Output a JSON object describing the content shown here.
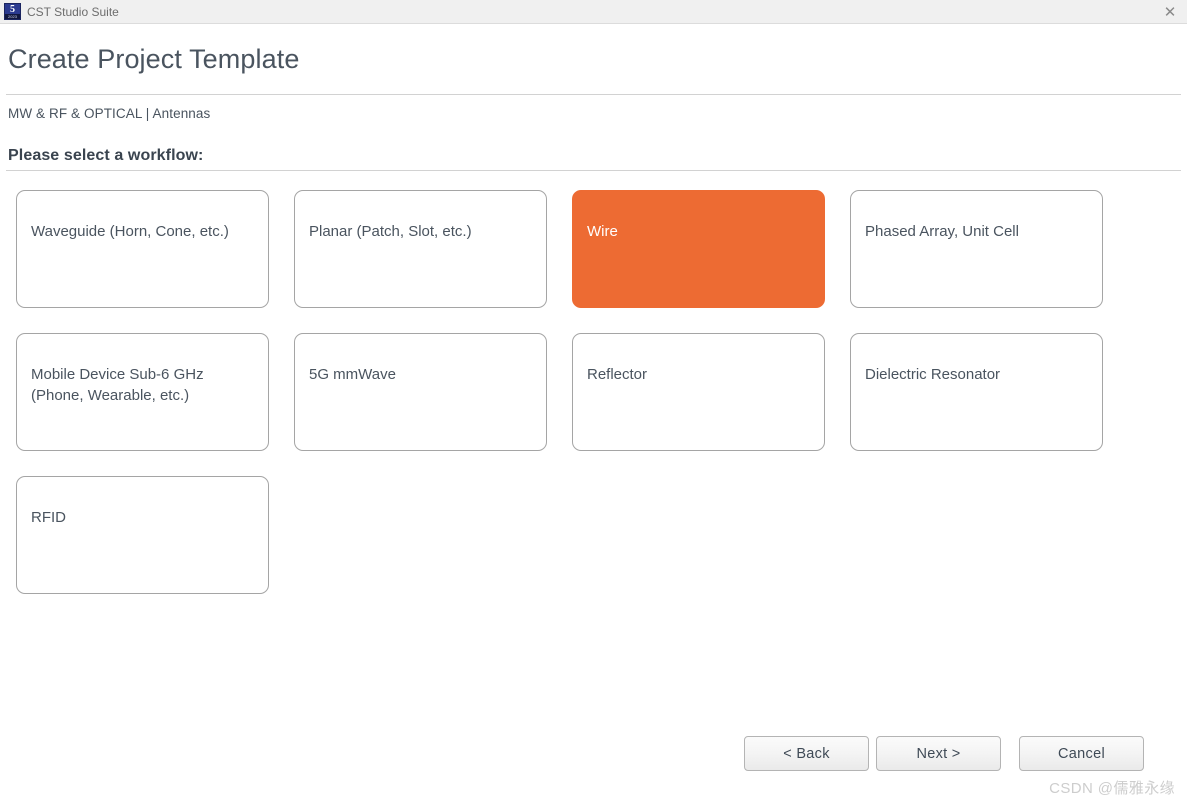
{
  "window": {
    "title": "CST Studio Suite",
    "icon": "cst-app-icon",
    "icon_glyph": "5",
    "icon_year": "2023",
    "close_label": "✕"
  },
  "header": {
    "page_title": "Create Project Template",
    "breadcrumb": "MW & RF & OPTICAL | Antennas",
    "section_title": "Please select a workflow:"
  },
  "workflows": {
    "selected": "Wire",
    "selected_color": "#ed6b33",
    "items": [
      {
        "label": "Waveguide (Horn, Cone, etc.)",
        "selected": false
      },
      {
        "label": "Planar (Patch, Slot, etc.)",
        "selected": false
      },
      {
        "label": "Wire",
        "selected": true
      },
      {
        "label": "Phased Array, Unit Cell",
        "selected": false
      },
      {
        "label": "Mobile Device Sub-6 GHz (Phone, Wearable, etc.)",
        "selected": false
      },
      {
        "label": "5G mmWave",
        "selected": false
      },
      {
        "label": "Reflector",
        "selected": false
      },
      {
        "label": "Dielectric Resonator",
        "selected": false
      },
      {
        "label": "RFID",
        "selected": false
      }
    ]
  },
  "footer": {
    "back_label": "< Back",
    "next_label": "Next >",
    "cancel_label": "Cancel"
  },
  "watermark": {
    "text": "CSDN @儒雅永缘"
  }
}
